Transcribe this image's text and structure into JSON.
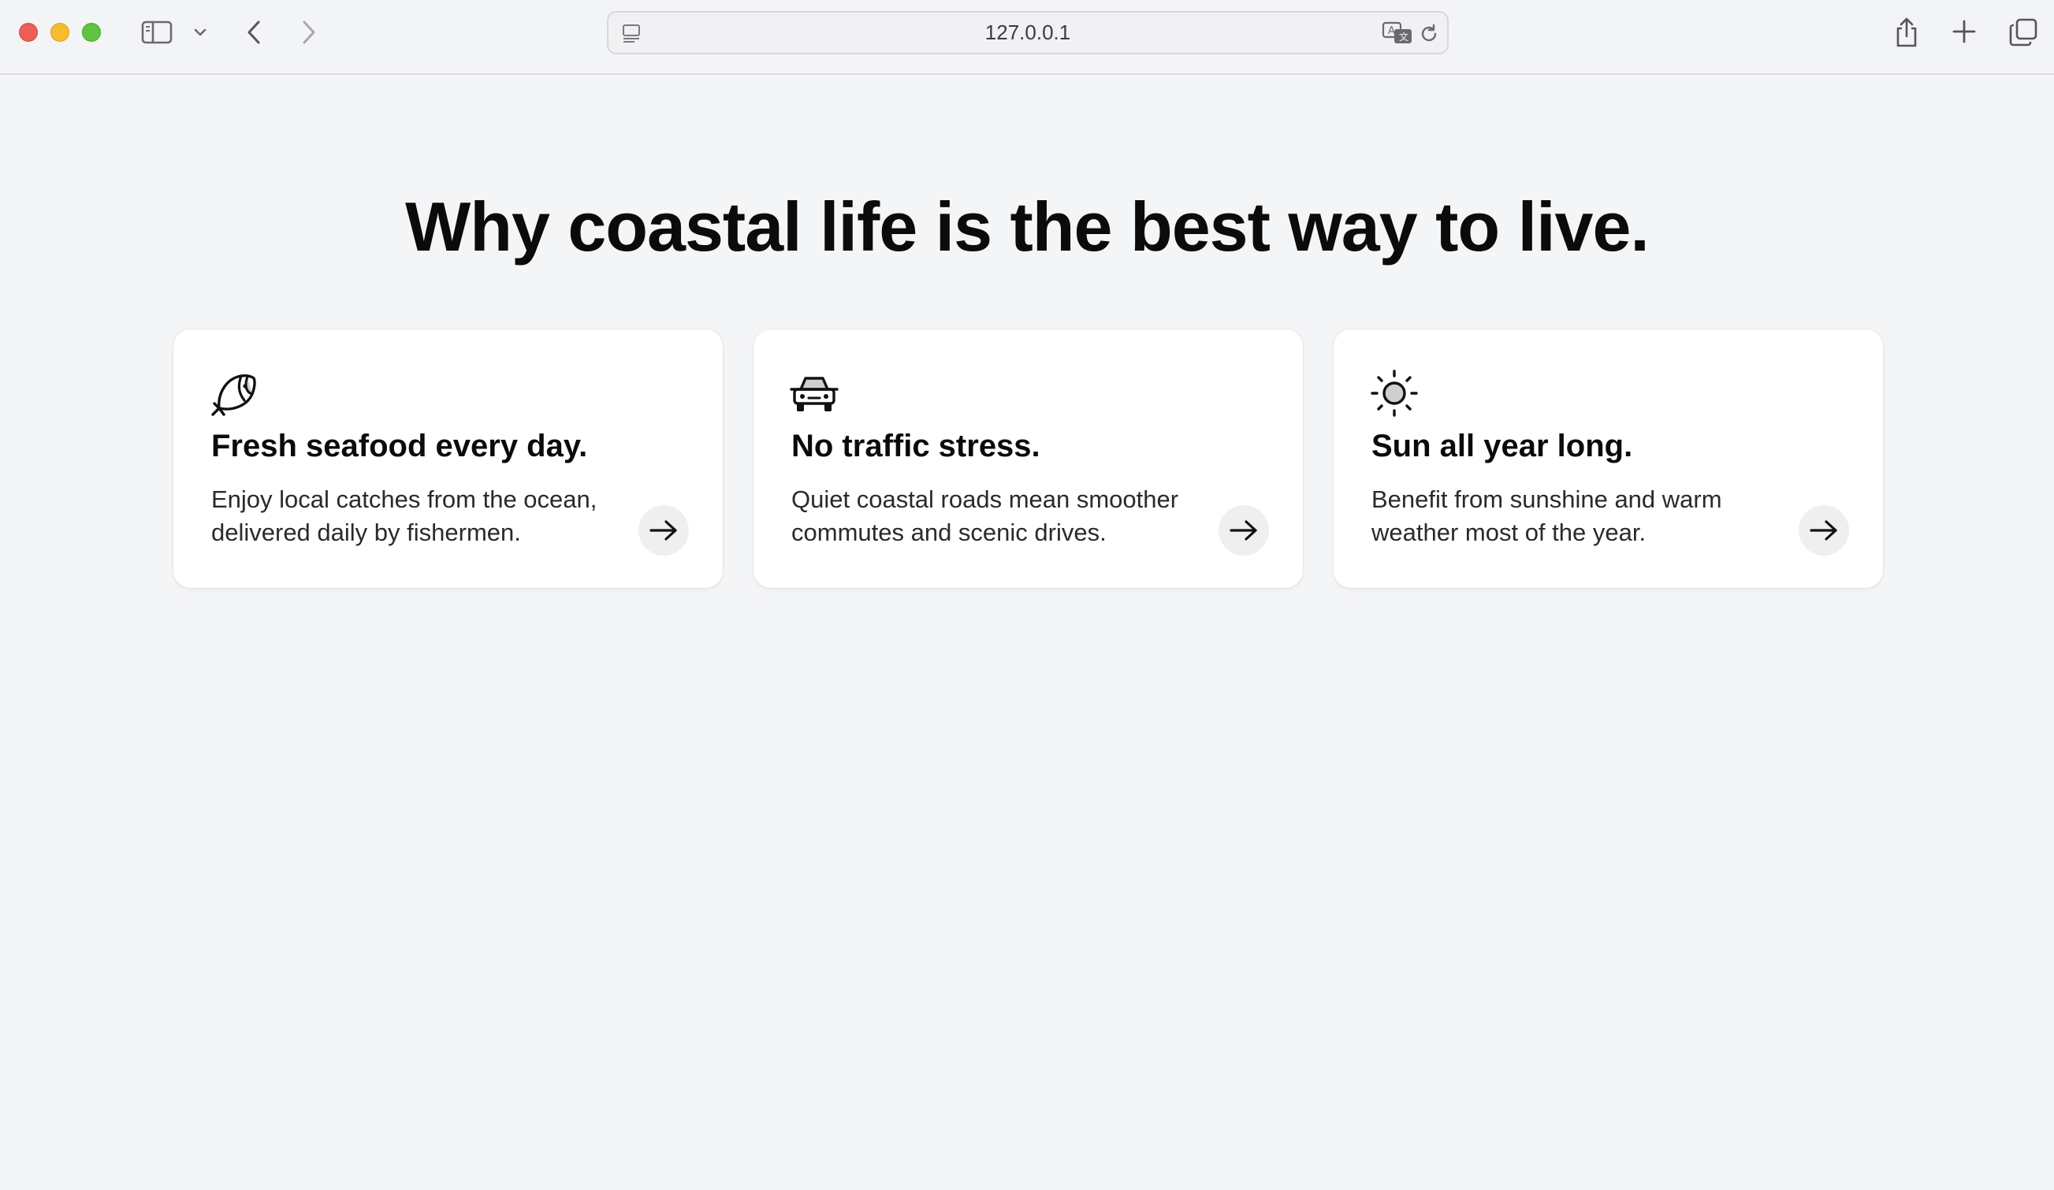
{
  "browser": {
    "url": "127.0.0.1",
    "icons": {
      "sidebar": "sidebar-icon",
      "chevron": "chevron-down-icon",
      "back": "back-icon",
      "forward": "forward-icon",
      "site_info": "page-settings-icon",
      "translate": "translate-icon",
      "reload": "reload-icon",
      "share": "share-icon",
      "new_tab": "plus-icon",
      "tabs": "tabs-overview-icon"
    }
  },
  "page": {
    "headline": "Why coastal life is the best way to live.",
    "cards": [
      {
        "icon": "fish-icon",
        "title": "Fresh seafood every day.",
        "desc_line1": "Enjoy local catches from the ocean,",
        "desc_line2": "delivered daily by fishermen."
      },
      {
        "icon": "car-icon",
        "title": "No traffic stress.",
        "desc_line1": "Quiet coastal roads mean smoother",
        "desc_line2": "commutes and scenic drives."
      },
      {
        "icon": "sun-icon",
        "title": "Sun all year long.",
        "desc_line1": "Benefit from sunshine and warm",
        "desc_line2": "weather most of the year."
      }
    ]
  },
  "colors": {
    "page_bg": "#f4f5f7",
    "card_bg": "#ffffff",
    "text": "#0b0b0c",
    "arrow_bg": "#efefef"
  }
}
